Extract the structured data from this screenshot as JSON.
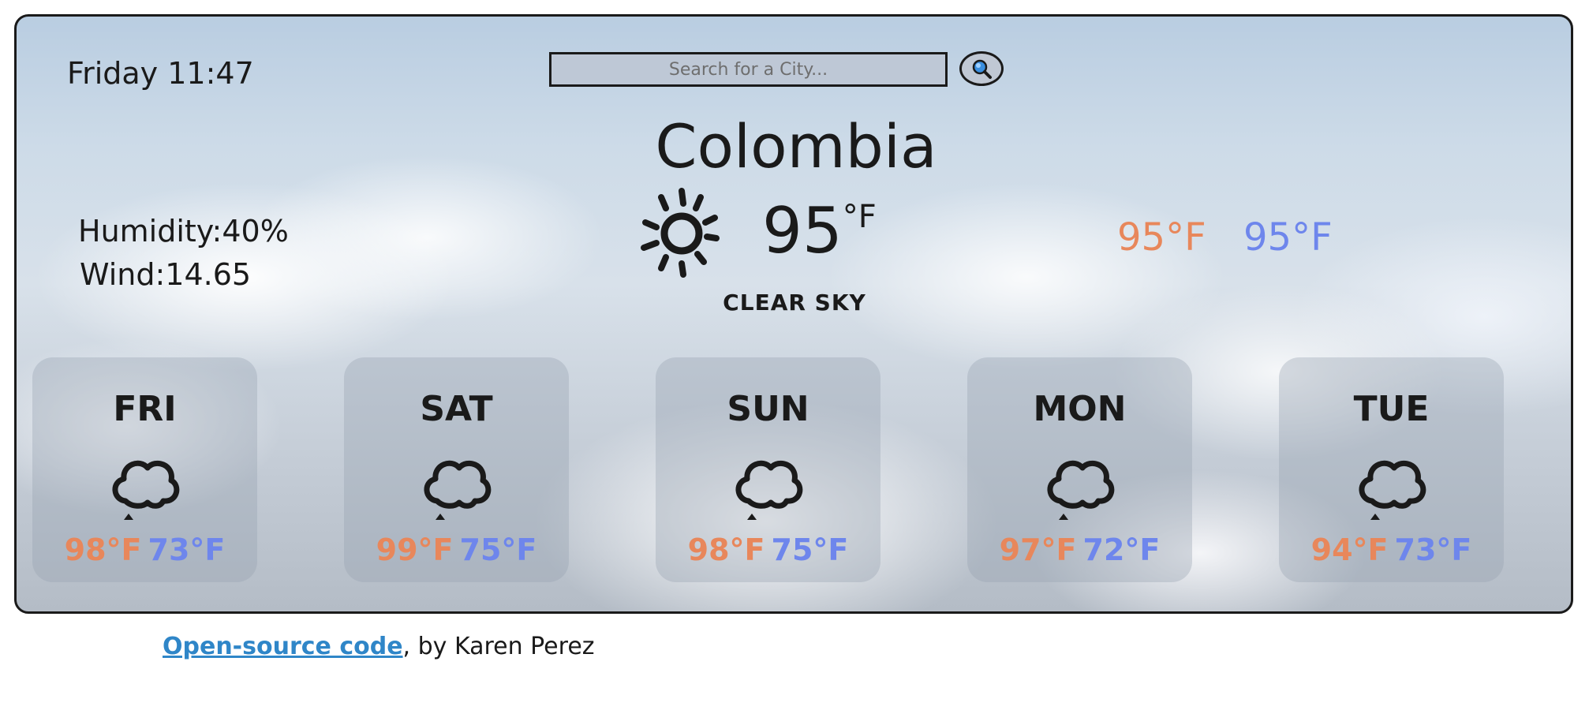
{
  "header": {
    "datetime": "Friday 11:47",
    "search_placeholder": "Search for a City...",
    "search_icon": "magnifier-icon"
  },
  "current": {
    "city": "Colombia",
    "icon": "sun-icon",
    "temperature": "95",
    "unit": "°F",
    "description": "CLEAR SKY",
    "humidity": "Humidity:40%",
    "wind": "Wind:14.65",
    "high": "95°F",
    "low": "95°F"
  },
  "forecast": [
    {
      "day": "FRI",
      "icon": "cloud-icon",
      "high": "98°F",
      "low": "73°F"
    },
    {
      "day": "SAT",
      "icon": "cloud-icon",
      "high": "99°F",
      "low": "75°F"
    },
    {
      "day": "SUN",
      "icon": "cloud-icon",
      "high": "98°F",
      "low": "75°F"
    },
    {
      "day": "MON",
      "icon": "cloud-icon",
      "high": "97°F",
      "low": "72°F"
    },
    {
      "day": "TUE",
      "icon": "cloud-icon",
      "high": "94°F",
      "low": "73°F"
    }
  ],
  "footer": {
    "link_text": "Open-source code",
    "suffix": ", by Karen Perez"
  },
  "colors": {
    "high": "#e8875b",
    "low": "#6e86ec",
    "link": "#2f86c8"
  }
}
